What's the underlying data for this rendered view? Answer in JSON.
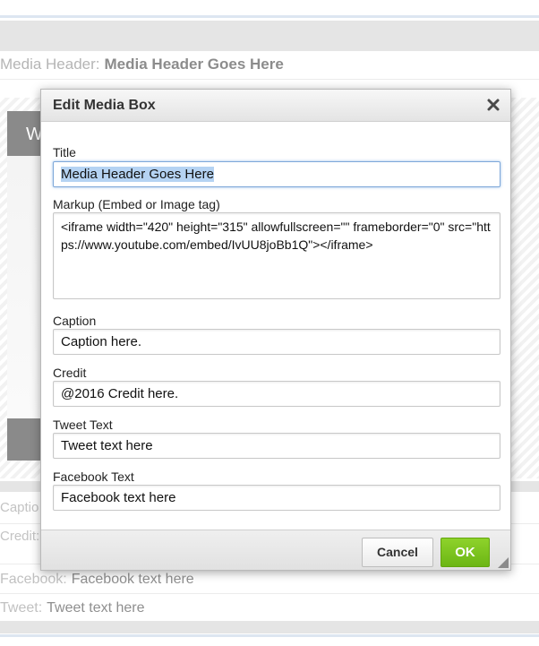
{
  "background": {
    "media_header_label": "Media Header:",
    "media_header_value": "Media Header Goes Here",
    "media_preview_letter": "W",
    "caption_label_partial": "Captio",
    "credit_label_partial": "Credit:",
    "facebook_label": "Facebook:",
    "facebook_value": "Facebook text here",
    "tweet_label": "Tweet:",
    "tweet_value": "Tweet text here"
  },
  "dialog": {
    "title": "Edit Media Box",
    "close_icon": "close-x-icon",
    "fields": {
      "title": {
        "label": "Title",
        "value": "Media Header Goes Here"
      },
      "markup": {
        "label": "Markup (Embed or Image tag)",
        "value": "<iframe width=\"420\" height=\"315\" allowfullscreen=\"\" frameborder=\"0\" src=\"https://www.youtube.com/embed/IvUU8joBb1Q\"></iframe>"
      },
      "caption": {
        "label": "Caption",
        "value": "Caption here."
      },
      "credit": {
        "label": "Credit",
        "value": "@2016 Credit here."
      },
      "tweet_text": {
        "label": "Tweet Text",
        "value": "Tweet text here"
      },
      "facebook_text": {
        "label": "Facebook Text",
        "value": "Facebook text here"
      }
    },
    "buttons": {
      "cancel": "Cancel",
      "ok": "OK"
    },
    "colors": {
      "ok_green": "#7cc41f",
      "focus_blue": "#7ea8d9",
      "selection": "#b5d3f3"
    }
  }
}
